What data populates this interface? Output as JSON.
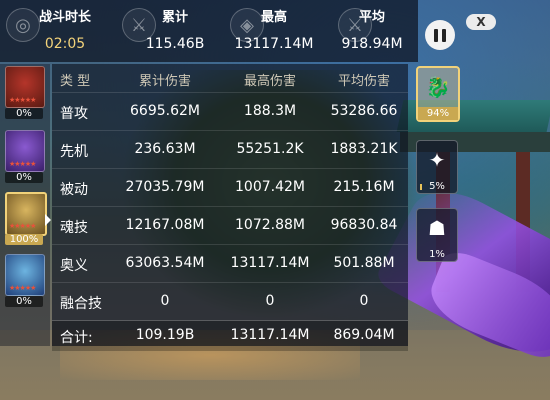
{
  "header": {
    "duration_label": "战斗时长",
    "duration_value": "02:05",
    "total_label": "累计",
    "total_value": "115.46B",
    "max_label": "最高",
    "max_value": "13117.14M",
    "avg_label": "平均",
    "avg_value": "918.94M"
  },
  "controls": {
    "close_label": "X"
  },
  "characters": [
    {
      "name": "character-1",
      "percent": "0%",
      "stars": "★★★★★",
      "colors": [
        "#b5352a",
        "#5a1a12"
      ]
    },
    {
      "name": "character-2",
      "percent": "0%",
      "stars": "★★★★★",
      "colors": [
        "#8a5ad0",
        "#3a1f6a"
      ]
    },
    {
      "name": "character-3",
      "percent": "100%",
      "stars": "★★★★★",
      "colors": [
        "#d8b55f",
        "#6a5020"
      ],
      "active": true
    },
    {
      "name": "character-4",
      "percent": "0%",
      "stars": "★★★★★",
      "colors": [
        "#6db4e0",
        "#1f3f7a"
      ]
    }
  ],
  "table": {
    "headers": [
      "类 型",
      "累计伤害",
      "最高伤害",
      "平均伤害"
    ],
    "rows": [
      [
        "普攻",
        "6695.62M",
        "188.3M",
        "53286.66"
      ],
      [
        "先机",
        "236.63M",
        "55251.2K",
        "1883.21K"
      ],
      [
        "被动",
        "27035.79M",
        "1007.42M",
        "215.16M"
      ],
      [
        "魂技",
        "12167.08M",
        "1072.88M",
        "96830.84"
      ],
      [
        "奥义",
        "63063.54M",
        "13117.14M",
        "501.88M"
      ],
      [
        "融合技",
        "0",
        "0",
        "0"
      ]
    ],
    "total": [
      "合计:",
      "109.19B",
      "13117.14M",
      "869.04M"
    ]
  },
  "skills": [
    {
      "icon": "dragon-skill-icon",
      "glyph": "🐉",
      "percent": "94%",
      "active": true
    },
    {
      "icon": "shuriken-skill-icon",
      "glyph": "✦",
      "percent": "5%",
      "fill": 0.05
    },
    {
      "icon": "beast-skill-icon",
      "glyph": "☗",
      "percent": "1%"
    }
  ],
  "colors": {
    "gold": "#f3d37a",
    "accent_border": "#f1d27a",
    "star_red": "#e8523b"
  }
}
